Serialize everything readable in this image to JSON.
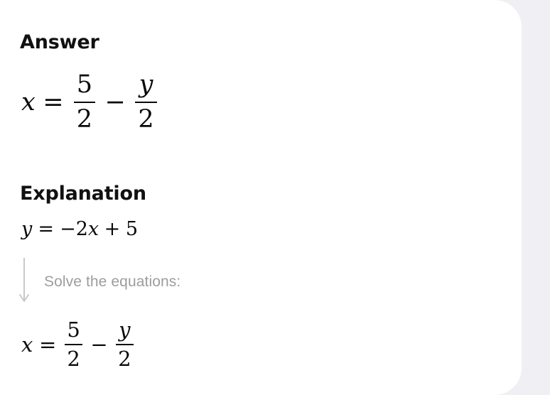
{
  "theme": {
    "backdrop_color": "#efeff4",
    "card_color": "#ffffff",
    "heading_color": "#111111",
    "math_color": "#0a0a0a",
    "muted_color": "#9d9d9d",
    "arrow_color": "#c9c9c9"
  },
  "answer_section": {
    "heading": "Answer",
    "equation": {
      "plain_text": "x = 5/2 - y/2",
      "lhs": "x",
      "relation": "=",
      "term1": {
        "numerator": "5",
        "denominator": "2"
      },
      "operator": "−",
      "term2": {
        "numerator": "y",
        "denominator": "2"
      }
    }
  },
  "explanation_section": {
    "heading": "Explanation",
    "given_equation": {
      "plain_text": "y = -2x + 5",
      "lhs": "y",
      "relation": "=",
      "sign": "−",
      "coefficient": "2",
      "variable": "x",
      "operator": "+",
      "constant": "5"
    },
    "step": {
      "arrow_icon": "down-arrow-icon",
      "caption": "Solve the equations:"
    },
    "result_equation": {
      "plain_text": "x = 5/2 - y/2",
      "lhs": "x",
      "relation": "=",
      "term1": {
        "numerator": "5",
        "denominator": "2"
      },
      "operator": "−",
      "term2": {
        "numerator": "y",
        "denominator": "2"
      }
    }
  }
}
